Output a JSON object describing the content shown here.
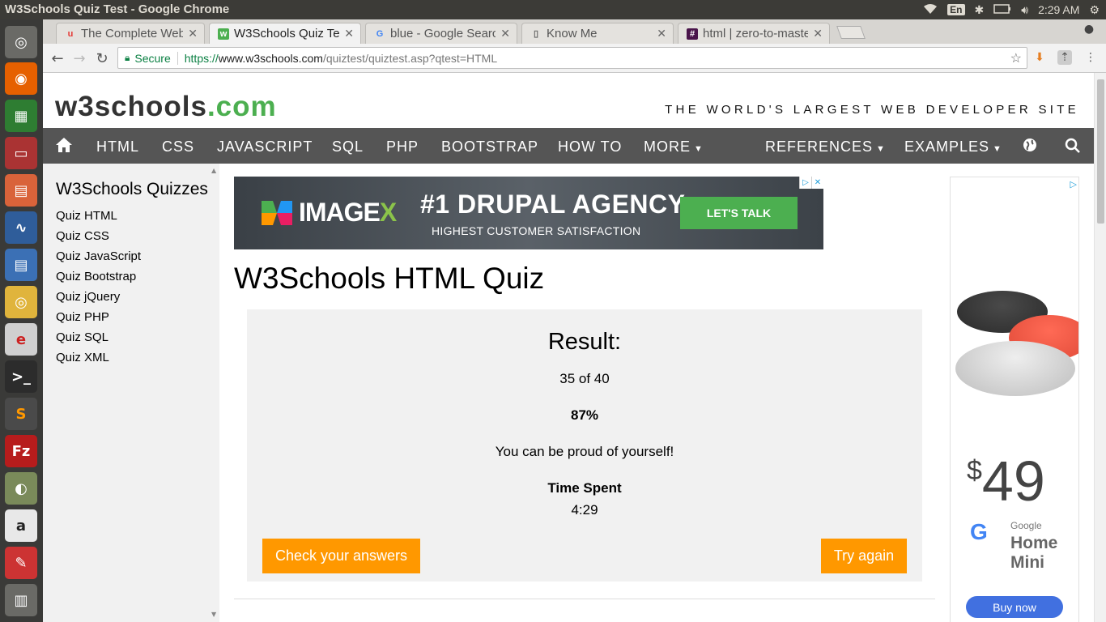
{
  "desktop": {
    "window_title": "W3Schools Quiz Test - Google Chrome",
    "keyboard_layout": "En",
    "clock": "2:29 AM"
  },
  "launcher": {
    "items": [
      "dash-icon",
      "firefox-icon",
      "calc-icon",
      "files-icon",
      "impress-icon",
      "monitor-icon",
      "writer-icon",
      "chrome-icon",
      "e-icon",
      "terminal-icon",
      "sublime-icon",
      "filezilla-icon",
      "image-viewer-icon",
      "amazon-icon",
      "settings-icon",
      "trash-icon"
    ]
  },
  "browser": {
    "tabs": [
      {
        "label": "The Complete Web",
        "icon": "udemy-icon"
      },
      {
        "label": "W3Schools Quiz Te",
        "icon": "w3-icon"
      },
      {
        "label": "blue - Google Searc",
        "icon": "google-icon"
      },
      {
        "label": "Know Me",
        "icon": "page-icon"
      },
      {
        "label": "html | zero-to-maste",
        "icon": "slack-icon"
      }
    ],
    "secure_label": "Secure",
    "url_scheme": "https://",
    "url_host": "www.w3schools.com",
    "url_path": "/quiztest/quiztest.asp?qtest=HTML"
  },
  "site": {
    "logo_main": "w3schools",
    "logo_tld": ".com",
    "tagline": "THE WORLD'S LARGEST WEB DEVELOPER SITE",
    "nav": [
      "HTML",
      "CSS",
      "JAVASCRIPT",
      "SQL",
      "PHP",
      "BOOTSTRAP",
      "HOW TO",
      "MORE",
      "REFERENCES",
      "EXAMPLES"
    ],
    "accent_color": "#4caf50",
    "button_color": "#ff9800"
  },
  "sidebar": {
    "heading": "W3Schools Quizzes",
    "links": [
      "Quiz HTML",
      "Quiz CSS",
      "Quiz JavaScript",
      "Quiz Bootstrap",
      "Quiz jQuery",
      "Quiz PHP",
      "Quiz SQL",
      "Quiz XML"
    ]
  },
  "banner_ad": {
    "brand": "IMAGE",
    "brand_x": "X",
    "headline": "#1 DRUPAL AGENCY",
    "subline": "HIGHEST CUSTOMER SATISFACTION",
    "cta": "LET'S TALK"
  },
  "main": {
    "title": "W3Schools HTML Quiz",
    "result_heading": "Result:",
    "score": "35 of 40",
    "percent": "87%",
    "message": "You can be proud of yourself!",
    "time_label": "Time Spent",
    "time_value": "4:29",
    "check_button": "Check your answers",
    "try_button": "Try again"
  },
  "side_ad": {
    "price_symbol": "$",
    "price": "49",
    "brand": "Google",
    "product_line1": "Home",
    "product_line2": "Mini",
    "cta": "Buy now"
  }
}
